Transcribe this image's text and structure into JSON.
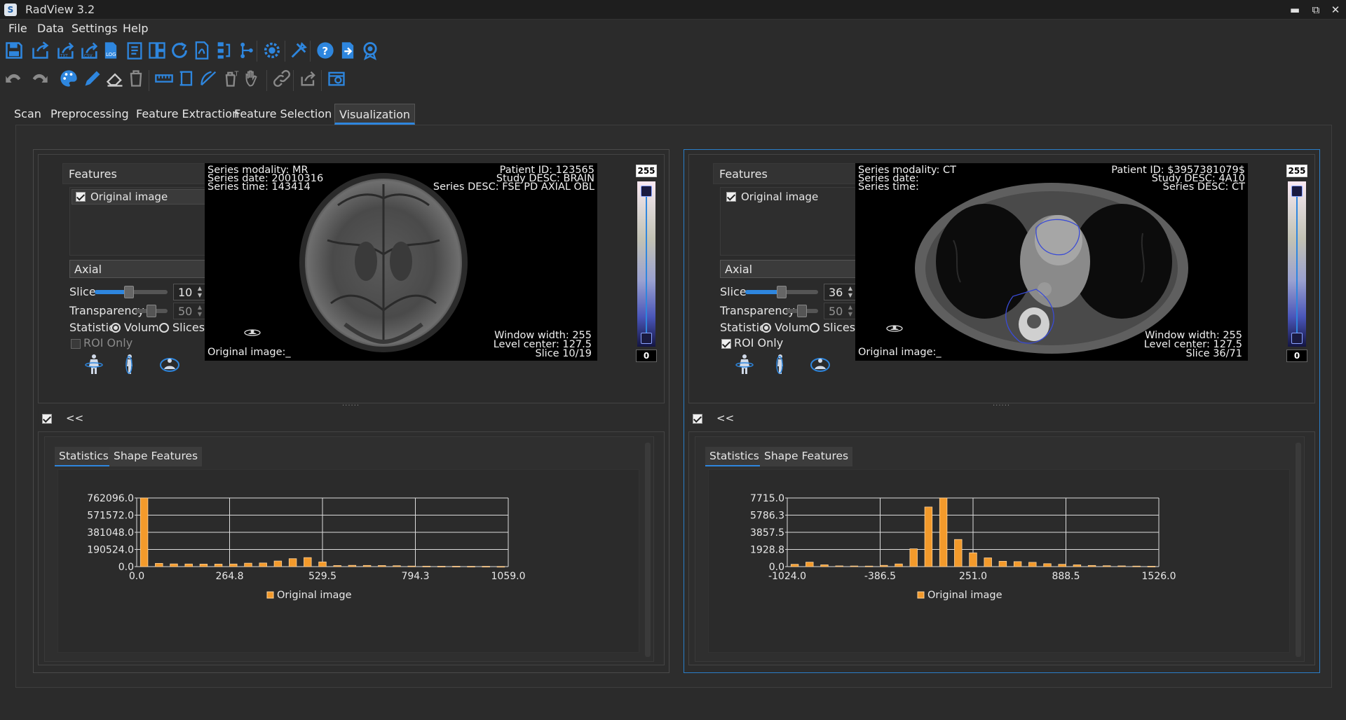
{
  "window": {
    "title": "RadView 3.2",
    "logo_text": "S",
    "min": "▬",
    "max": "⧉",
    "close": "✕"
  },
  "menu": [
    "File",
    "Data",
    "Settings",
    "Help"
  ],
  "main_tabs": [
    {
      "label": "Scan"
    },
    {
      "label": "Preprocessing"
    },
    {
      "label": "Feature Extraction"
    },
    {
      "label": "Feature Selection"
    },
    {
      "label": "Visualization",
      "active": true
    }
  ],
  "toolbar1_icons": [
    "save-icon",
    "open-icon",
    "export-icon",
    "export-csv-icon",
    "log-icon",
    "report-icon",
    "layout-icon",
    "refresh-icon",
    "pdf-icon",
    "flowchart-icon",
    "tree-icon",
    "settings-icon",
    "tools-icon",
    "help-icon",
    "exit-icon",
    "award-icon"
  ],
  "toolbar2_icons": [
    "undo-icon",
    "redo-icon",
    "palette-icon",
    "pencil-icon",
    "eraser-icon",
    "delete-icon",
    "ruler-icon",
    "crop-icon",
    "protractor-icon",
    "delete-text-icon",
    "hand-icon",
    "link-icon",
    "share-icon",
    "screenshot-icon"
  ],
  "colors": {
    "accent": "#2e86de",
    "bar": "#f39a2b",
    "bar_edge": "#ffd39a",
    "panel": "#2b2b2b"
  },
  "left": {
    "features_title": "Features",
    "feature_item": "Original image",
    "view": "Axial",
    "slice_label": "Slice",
    "slice_value": "10",
    "slice_level": 0.47,
    "transparency_label": "Transparency",
    "transparency_value": "50",
    "statistics_label": "Statistics",
    "volume_label": "Volume",
    "slices_label": "Slices",
    "roi_label": "ROI Only",
    "overlay": {
      "modality": "Series modality: MR",
      "date": "Series date: 20010316",
      "time": "Series time: 143414",
      "patient": "Patient ID: 123565",
      "study": "Study DESC: BRAIN",
      "series": "Series DESC: FSE PD AXIAL OBL",
      "window_width": "Window width: 255",
      "level_center": "Level center: 127.5",
      "slice": "Slice 10/19",
      "image_label": "Original image:_"
    },
    "cbar_max": "255",
    "cbar_min": "0",
    "lower_toggle": "<<",
    "stats_tab": "Statistics",
    "shape_tab": "Shape Features"
  },
  "right": {
    "features_title": "Features",
    "feature_item": "Original image",
    "view": "Axial",
    "slice_label": "Slice",
    "slice_value": "36",
    "slice_level": 0.5,
    "transparency_label": "Transparency",
    "transparency_value": "50",
    "statistics_label": "Statistics",
    "volume_label": "Volume",
    "slices_label": "Slices",
    "roi_label": "ROI Only",
    "overlay": {
      "modality": "Series modality: CT",
      "date": "Series date:",
      "time": "Series time:",
      "patient": "Patient ID: $3957381079$",
      "study": "Study DESC: 4A10",
      "series": "Series DESC: CT",
      "window_width": "Window width: 255",
      "level_center": "Level center: 127.5",
      "slice": "Slice 36/71",
      "image_label": "Original image:_"
    },
    "cbar_max": "255",
    "cbar_min": "0",
    "lower_toggle": "<<",
    "stats_tab": "Statistics",
    "shape_tab": "Shape Features"
  },
  "chart_data": [
    {
      "type": "bar",
      "ylim": [
        0,
        762096.0
      ],
      "xlim": [
        0.0,
        1059.0
      ],
      "yticks": [
        "762096.0",
        "571572.0",
        "381048.0",
        "190524.0",
        "0.0"
      ],
      "xticks": [
        "0.0",
        "264.8",
        "529.5",
        "794.3",
        "1059.0"
      ],
      "x": [
        0,
        42.4,
        84.7,
        127.1,
        169.4,
        211.8,
        254.2,
        296.5,
        338.9,
        381.2,
        423.6,
        466.0,
        508.3,
        550.7,
        593.0,
        635.4,
        677.8,
        720.1,
        762.5,
        804.8,
        847.2,
        889.6,
        931.9,
        974.3,
        1016.6
      ],
      "values": [
        762096,
        36000,
        30000,
        29000,
        28000,
        28000,
        29000,
        38000,
        40000,
        62000,
        88000,
        100000,
        52000,
        12000,
        14000,
        13000,
        12000,
        10000,
        6000,
        5000,
        4000,
        4000,
        3000,
        3000,
        2000
      ],
      "series": [
        {
          "name": "Original image"
        }
      ]
    },
    {
      "type": "bar",
      "ylim": [
        0,
        7715.0
      ],
      "xlim": [
        -1024.0,
        1526.0
      ],
      "yticks": [
        "7715.0",
        "5786.3",
        "3857.5",
        "1928.8",
        "0.0"
      ],
      "xticks": [
        "-1024.0",
        "-386.5",
        "251.0",
        "888.5",
        "1526.0"
      ],
      "x": [
        -1024,
        -922,
        -820,
        -718,
        -616,
        -514,
        -412,
        -310,
        -208,
        -106,
        -4,
        98,
        200,
        302,
        404,
        506,
        608,
        710,
        812,
        914,
        1016,
        1118,
        1220,
        1322,
        1424
      ],
      "values": [
        260,
        500,
        200,
        80,
        70,
        60,
        140,
        300,
        2000,
        6700,
        7715,
        3050,
        1550,
        980,
        600,
        560,
        480,
        330,
        260,
        200,
        130,
        100,
        80,
        60,
        40
      ],
      "series": [
        {
          "name": "Original image"
        }
      ]
    }
  ]
}
